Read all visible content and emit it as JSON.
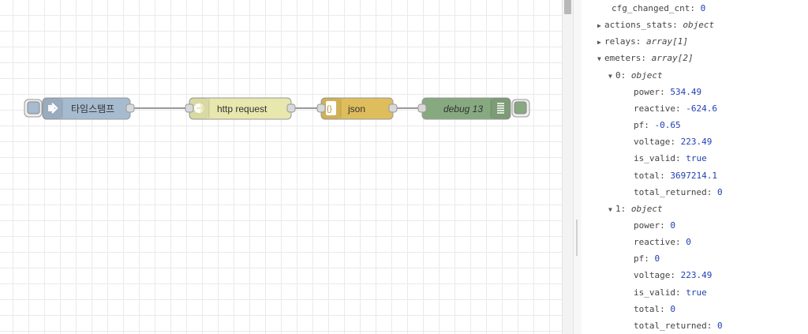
{
  "flow": {
    "nodes": [
      {
        "id": "inject",
        "label": "타임스탬프",
        "icon": "arrow-in-icon",
        "color": "#a6bbcf"
      },
      {
        "id": "http",
        "label": "http request",
        "icon": "globe-icon",
        "color": "#e7e7ae"
      },
      {
        "id": "json",
        "label": "json",
        "icon": "braces-icon",
        "color": "#debd5c"
      },
      {
        "id": "debug",
        "label": "debug 13",
        "icon": "list-icon",
        "color": "#87a980"
      }
    ]
  },
  "debug": {
    "rows": [
      {
        "depth": 0,
        "toggle": "",
        "key": "cfg_changed_cnt",
        "value": "0",
        "type": "value"
      },
      {
        "depth": 0,
        "toggle": "▶",
        "key": "actions_stats",
        "value": "object",
        "type": "italic"
      },
      {
        "depth": 0,
        "toggle": "▶",
        "key": "relays",
        "value": "array[1]",
        "type": "italic"
      },
      {
        "depth": 0,
        "toggle": "▼",
        "key": "emeters",
        "value": "array[2]",
        "type": "italic"
      },
      {
        "depth": 1,
        "toggle": "▼",
        "key": "0",
        "value": "object",
        "type": "italic"
      },
      {
        "depth": 2,
        "toggle": "",
        "key": "power",
        "value": "534.49",
        "type": "value"
      },
      {
        "depth": 2,
        "toggle": "",
        "key": "reactive",
        "value": "-624.6",
        "type": "value"
      },
      {
        "depth": 2,
        "toggle": "",
        "key": "pf",
        "value": "-0.65",
        "type": "value"
      },
      {
        "depth": 2,
        "toggle": "",
        "key": "voltage",
        "value": "223.49",
        "type": "value"
      },
      {
        "depth": 2,
        "toggle": "",
        "key": "is_valid",
        "value": "true",
        "type": "value"
      },
      {
        "depth": 2,
        "toggle": "",
        "key": "total",
        "value": "3697214.1",
        "type": "value"
      },
      {
        "depth": 2,
        "toggle": "",
        "key": "total_returned",
        "value": "0",
        "type": "value"
      },
      {
        "depth": 1,
        "toggle": "▼",
        "key": "1",
        "value": "object",
        "type": "italic"
      },
      {
        "depth": 2,
        "toggle": "",
        "key": "power",
        "value": "0",
        "type": "value"
      },
      {
        "depth": 2,
        "toggle": "",
        "key": "reactive",
        "value": "0",
        "type": "value"
      },
      {
        "depth": 2,
        "toggle": "",
        "key": "pf",
        "value": "0",
        "type": "value"
      },
      {
        "depth": 2,
        "toggle": "",
        "key": "voltage",
        "value": "223.49",
        "type": "value"
      },
      {
        "depth": 2,
        "toggle": "",
        "key": "is_valid",
        "value": "true",
        "type": "value"
      },
      {
        "depth": 2,
        "toggle": "",
        "key": "total",
        "value": "0",
        "type": "value"
      },
      {
        "depth": 2,
        "toggle": "",
        "key": "total_returned",
        "value": "0",
        "type": "value"
      }
    ]
  }
}
